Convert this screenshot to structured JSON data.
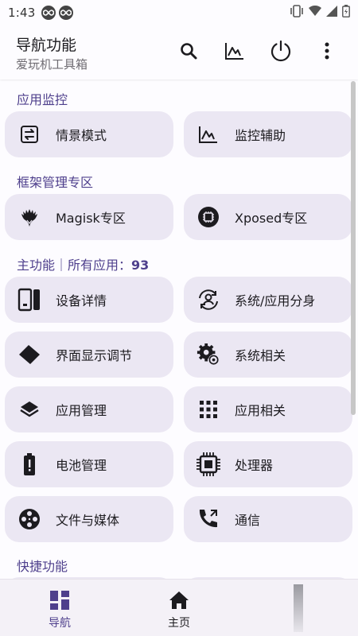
{
  "status_bar": {
    "time": "1:43"
  },
  "app_bar": {
    "title": "导航功能",
    "subtitle": "爱玩机工具箱"
  },
  "sections": [
    {
      "title": "应用监控"
    },
    {
      "title": "框架管理专区"
    },
    {
      "title": "主功能｜所有应用：",
      "count": "93"
    },
    {
      "title": "快捷功能"
    }
  ],
  "tiles": {
    "scene_mode": "情景模式",
    "monitor_assist": "监控辅助",
    "magisk": "Magisk专区",
    "xposed": "Xposed专区",
    "device_info": "设备详情",
    "app_clone": "系统/应用分身",
    "display_adjust": "界面显示调节",
    "system_related": "系统相关",
    "app_manage": "应用管理",
    "app_related": "应用相关",
    "battery_manage": "电池管理",
    "processor": "处理器",
    "file_media": "文件与媒体",
    "communication": "通信"
  },
  "bottom_nav": [
    {
      "label": "导航"
    },
    {
      "label": "主页"
    },
    {
      "label": ""
    }
  ],
  "colors": {
    "accent": "#4e3f8c",
    "tile_bg": "#ebe7f3",
    "background": "#fdfcff"
  }
}
